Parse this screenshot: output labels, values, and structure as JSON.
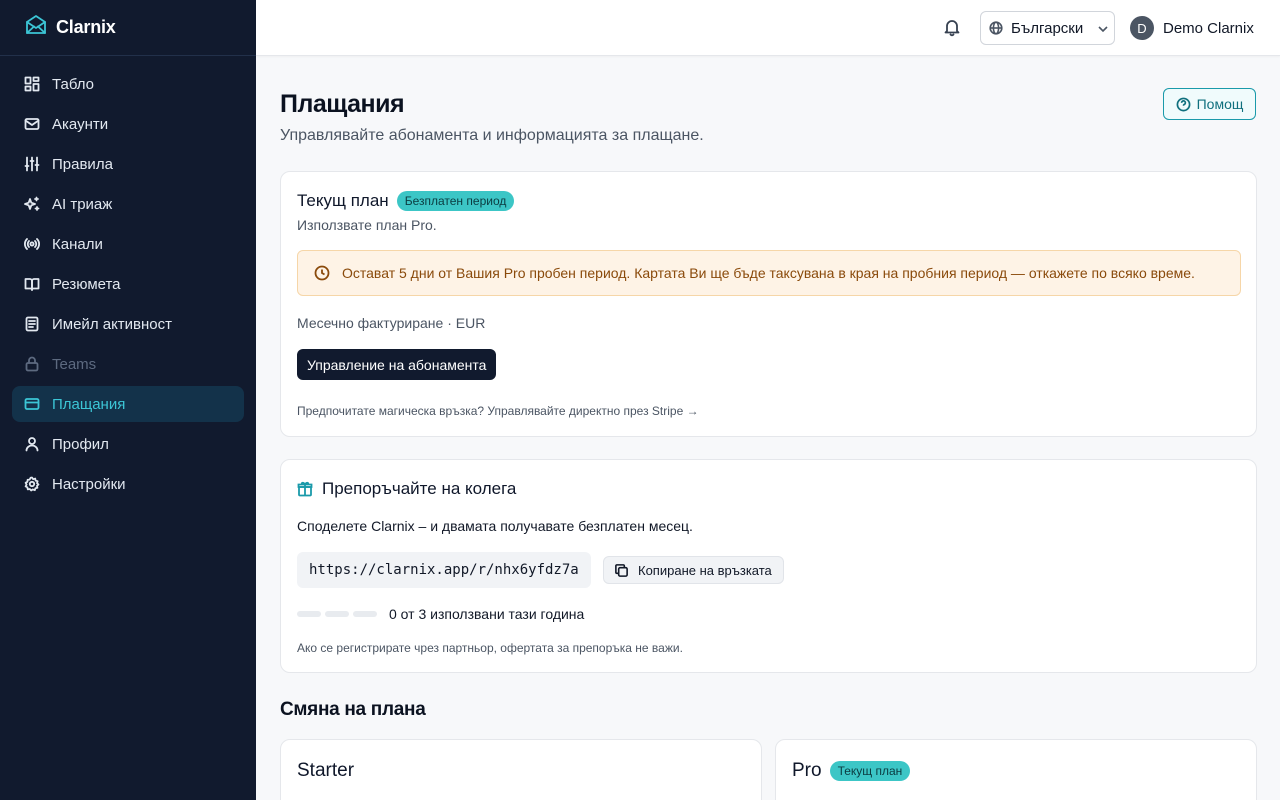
{
  "app": {
    "name": "Clarnix"
  },
  "sidebar": {
    "items": [
      {
        "label": "Табло",
        "icon": "dashboard-icon"
      },
      {
        "label": "Акаунти",
        "icon": "mail-icon"
      },
      {
        "label": "Правила",
        "icon": "sliders-icon"
      },
      {
        "label": "AI триаж",
        "icon": "sparkles-icon"
      },
      {
        "label": "Канали",
        "icon": "radio-icon"
      },
      {
        "label": "Резюмета",
        "icon": "book-icon"
      },
      {
        "label": "Имейл активност",
        "icon": "activity-icon"
      },
      {
        "label": "Teams",
        "icon": "lock-icon",
        "disabled": true
      },
      {
        "label": "Плащания",
        "icon": "credit-card-icon",
        "active": true
      },
      {
        "label": "Профил",
        "icon": "user-icon"
      },
      {
        "label": "Настройки",
        "icon": "gear-icon"
      }
    ]
  },
  "topbar": {
    "language": "Български",
    "user_initial": "D",
    "user_name": "Demo Clarnix"
  },
  "page": {
    "title": "Плащания",
    "subtitle": "Управлявайте абонамента и информацията за плащане.",
    "help_label": "Помощ"
  },
  "current_plan": {
    "title": "Текущ план",
    "badge": "Безплатен период",
    "using_text": "Използвате план Pro.",
    "alert": "Остават 5 дни от Вашия Pro пробен период. Картата Ви ще бъде таксувана в края на пробния период — откажете по всяко време.",
    "billing": "Месечно фактуриране · EUR",
    "manage_label": "Управление на абонамента",
    "magic_link": "Предпочитате магическа връзка? Управлявайте директно през Stripe →"
  },
  "referral": {
    "title": "Препоръчайте на колега",
    "share_text": "Споделете Clarnix – и двамата получавате безплатен месец.",
    "link": "https://clarnix.app/r/nhx6yfdz7a",
    "copy_label": "Копиране на връзката",
    "used": 0,
    "total": 3,
    "usage_text": "0 от 3 използвани тази година",
    "partner_note": "Ако се регистрирате чрез партньор, офертата за препоръка не важи."
  },
  "change_plan": {
    "title": "Смяна на плана",
    "plans": [
      {
        "name": "Starter",
        "badge": ""
      },
      {
        "name": "Pro",
        "badge": "Текущ план"
      }
    ]
  },
  "colors": {
    "sidebar_bg": "#111a2e",
    "accent": "#3cc6d6",
    "badge": "#3cc6c6",
    "alert_bg": "#fef3e6",
    "alert_text": "#8a4a0b"
  }
}
